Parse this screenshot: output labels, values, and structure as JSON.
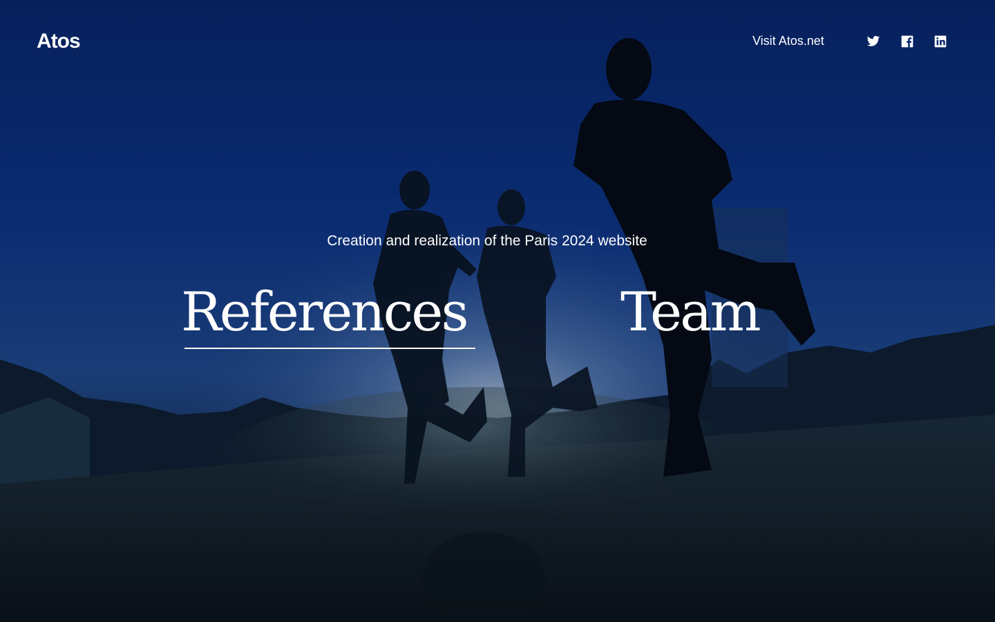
{
  "header": {
    "logo_text": "Atos",
    "visit_link": "Visit Atos.net",
    "social": [
      {
        "icon": "twitter-icon"
      },
      {
        "icon": "facebook-icon"
      },
      {
        "icon": "linkedin-icon"
      }
    ]
  },
  "hero": {
    "subtitle": "Creation and realization of the Paris 2024 website",
    "nav": {
      "references": "References",
      "team": "Team"
    },
    "active_item": "References"
  },
  "colors": {
    "sky_top": "#0a2a6e",
    "sky_glow": "#8fa7c7",
    "ground": "#0c1622",
    "text": "#ffffff"
  }
}
